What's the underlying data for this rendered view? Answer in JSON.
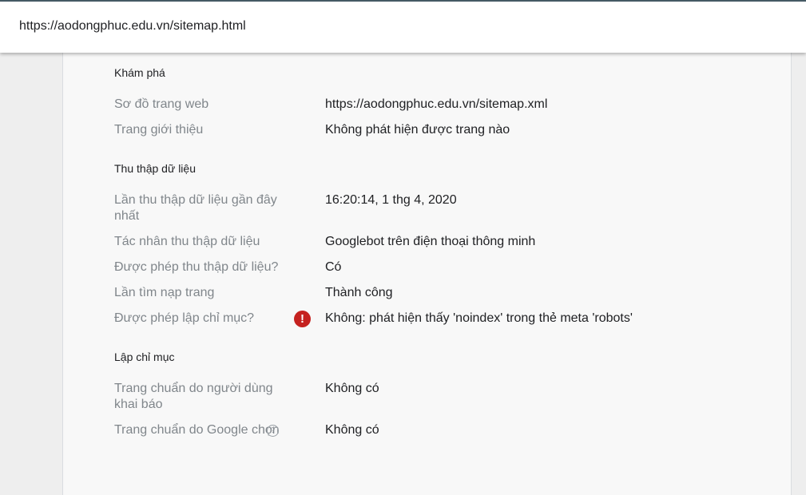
{
  "address_bar": {
    "url": "https://aodongphuc.edu.vn/sitemap.html"
  },
  "discovery": {
    "title": "Khám phá",
    "rows": [
      {
        "label": "Sơ đồ trang web",
        "value": "https://aodongphuc.edu.vn/sitemap.xml"
      },
      {
        "label": "Trang giới thiệu",
        "value": "Không phát hiện được trang nào"
      }
    ]
  },
  "crawl": {
    "title": "Thu thập dữ liệu",
    "rows": [
      {
        "label": "Lần thu thập dữ liệu gần đây nhất",
        "value": "16:20:14, 1 thg 4, 2020"
      },
      {
        "label": "Tác nhân thu thập dữ liệu",
        "value": "Googlebot trên điện thoại thông minh"
      },
      {
        "label": "Được phép thu thập dữ liệu?",
        "value": "Có"
      },
      {
        "label": "Lần tìm nạp trang",
        "value": "Thành công"
      },
      {
        "label": "Được phép lập chỉ mục?",
        "value": "Không: phát hiện thấy 'noindex' trong thẻ meta 'robots'"
      }
    ]
  },
  "indexing": {
    "title": "Lập chỉ mục",
    "rows": [
      {
        "label": "Trang chuẩn do người dùng khai báo",
        "value": "Không có"
      },
      {
        "label": "Trang chuẩn do Google chọn",
        "value": "Không có"
      }
    ]
  },
  "icons": {
    "error": "error-icon",
    "help": "help-icon",
    "error_glyph": "!",
    "help_glyph": "?"
  },
  "colors": {
    "error": "#c5221f",
    "label": "#80868b",
    "value": "#202124"
  }
}
